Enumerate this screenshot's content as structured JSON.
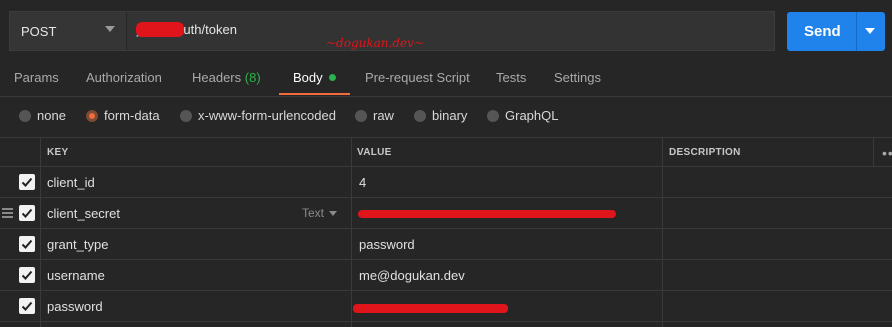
{
  "request": {
    "method": "POST",
    "url": "y.msi/oauth/token",
    "send_label": "Send"
  },
  "annotation": "~dogukan.dev~",
  "tabs": [
    {
      "label": "Params"
    },
    {
      "label": "Authorization"
    },
    {
      "label": "Headers",
      "count": "(8)"
    },
    {
      "label": "Body",
      "active": true
    },
    {
      "label": "Pre-request Script"
    },
    {
      "label": "Tests"
    },
    {
      "label": "Settings"
    }
  ],
  "body_types": [
    {
      "label": "none"
    },
    {
      "label": "form-data",
      "selected": true
    },
    {
      "label": "x-www-form-urlencoded"
    },
    {
      "label": "raw"
    },
    {
      "label": "binary"
    },
    {
      "label": "GraphQL"
    }
  ],
  "table": {
    "headers": {
      "key": "KEY",
      "value": "VALUE",
      "description": "DESCRIPTION"
    },
    "rows": [
      {
        "key": "client_id",
        "value": "4",
        "checked": true
      },
      {
        "key": "client_secret",
        "value": "",
        "type": "Text",
        "checked": true
      },
      {
        "key": "grant_type",
        "value": "password",
        "checked": true
      },
      {
        "key": "username",
        "value": "me@dogukan.dev",
        "checked": true
      },
      {
        "key": "password",
        "value": "",
        "checked": true
      }
    ]
  },
  "colors": {
    "accent": "#f26b3a",
    "send": "#1f83eb",
    "success": "#2bb24c",
    "redaction": "#e0141b"
  }
}
